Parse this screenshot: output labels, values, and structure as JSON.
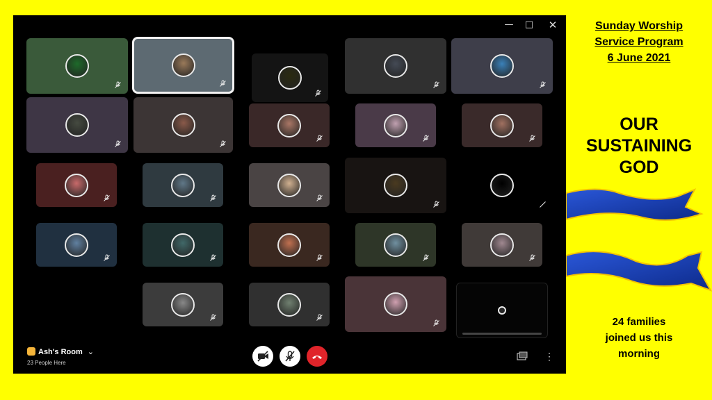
{
  "call": {
    "room_name": "Ash's Room",
    "people_count": "23 People Here"
  },
  "window_controls": [
    "minimize",
    "maximize",
    "close"
  ],
  "controls": {
    "camera": "camera-off",
    "mic": "mic-off",
    "leave": "end-call",
    "share": "share-screen",
    "more": "more-options"
  },
  "colors": {
    "background": "#ffff00",
    "window": "#000000",
    "end_call": "#e0242a",
    "ribbon": "#1a3fb0"
  },
  "participants_visible": 24,
  "program": {
    "title_line1": "Sunday Worship",
    "title_line2": "Service Program",
    "date": "6 June 2021",
    "theme_line1": "OUR",
    "theme_line2": "SUSTAINING",
    "theme_line3": "GOD",
    "note_line1": "24 families",
    "note_line2": "joined us this",
    "note_line3": "morning"
  }
}
